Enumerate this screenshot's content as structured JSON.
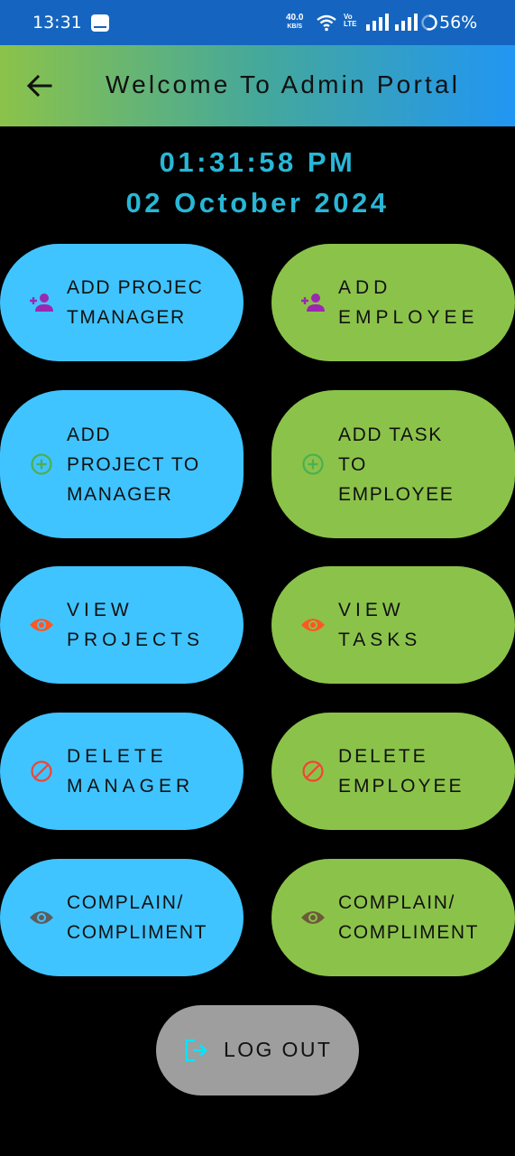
{
  "status_bar": {
    "time": "13:31",
    "net_speed_value": "40.0",
    "net_speed_unit": "KB/S",
    "volte_top": "Vo",
    "volte_bottom": "LTE",
    "battery": "56%"
  },
  "app_bar": {
    "title": "Welcome To Admin Portal",
    "back_icon": "arrow-back-icon",
    "gradient": [
      "#8bc34a",
      "#2196f3"
    ]
  },
  "clock": {
    "time": "01:31:58 PM",
    "date": "02 October 2024",
    "color": "#29b6d6"
  },
  "colors": {
    "blue_button": "#40c4ff",
    "green_button": "#8bc34a",
    "logout_button": "#9e9e9e",
    "person_add_icon": "#9c27b0",
    "add_circle_icon": "#4caf50",
    "visibility_icon": "#ff5722",
    "block_icon": "#f44336",
    "complain_icon": "#5d5d5d"
  },
  "buttons": {
    "add_project_manager": {
      "label": "ADD PROJEC\nTMANAGER",
      "icon": "person-add-icon"
    },
    "add_employee": {
      "label": "ADD\nEMPLOYEE",
      "icon": "person-add-icon"
    },
    "add_project_to_manager": {
      "label": "ADD\nPROJECT TO\nMANAGER",
      "icon": "add-circle-icon"
    },
    "add_task_to_employee": {
      "label": "ADD TASK\nTO\nEMPLOYEE",
      "icon": "add-circle-icon"
    },
    "view_projects": {
      "label": "VIEW\nPROJECTS",
      "icon": "visibility-icon"
    },
    "view_tasks": {
      "label": "VIEW\nTASKS",
      "icon": "visibility-icon"
    },
    "delete_manager": {
      "label": "DELETE\nMANAGER",
      "icon": "block-icon"
    },
    "delete_employee": {
      "label": "DELETE\nEMPLOYEE",
      "icon": "block-icon"
    },
    "complain_compliment_manager": {
      "label": "COMPLAIN/\nCOMPLIMENT",
      "icon": "visibility-icon"
    },
    "complain_compliment_employee": {
      "label": "COMPLAIN/\nCOMPLIMENT",
      "icon": "visibility-icon"
    },
    "logout": {
      "label": "LOG OUT",
      "icon": "logout-icon"
    }
  }
}
